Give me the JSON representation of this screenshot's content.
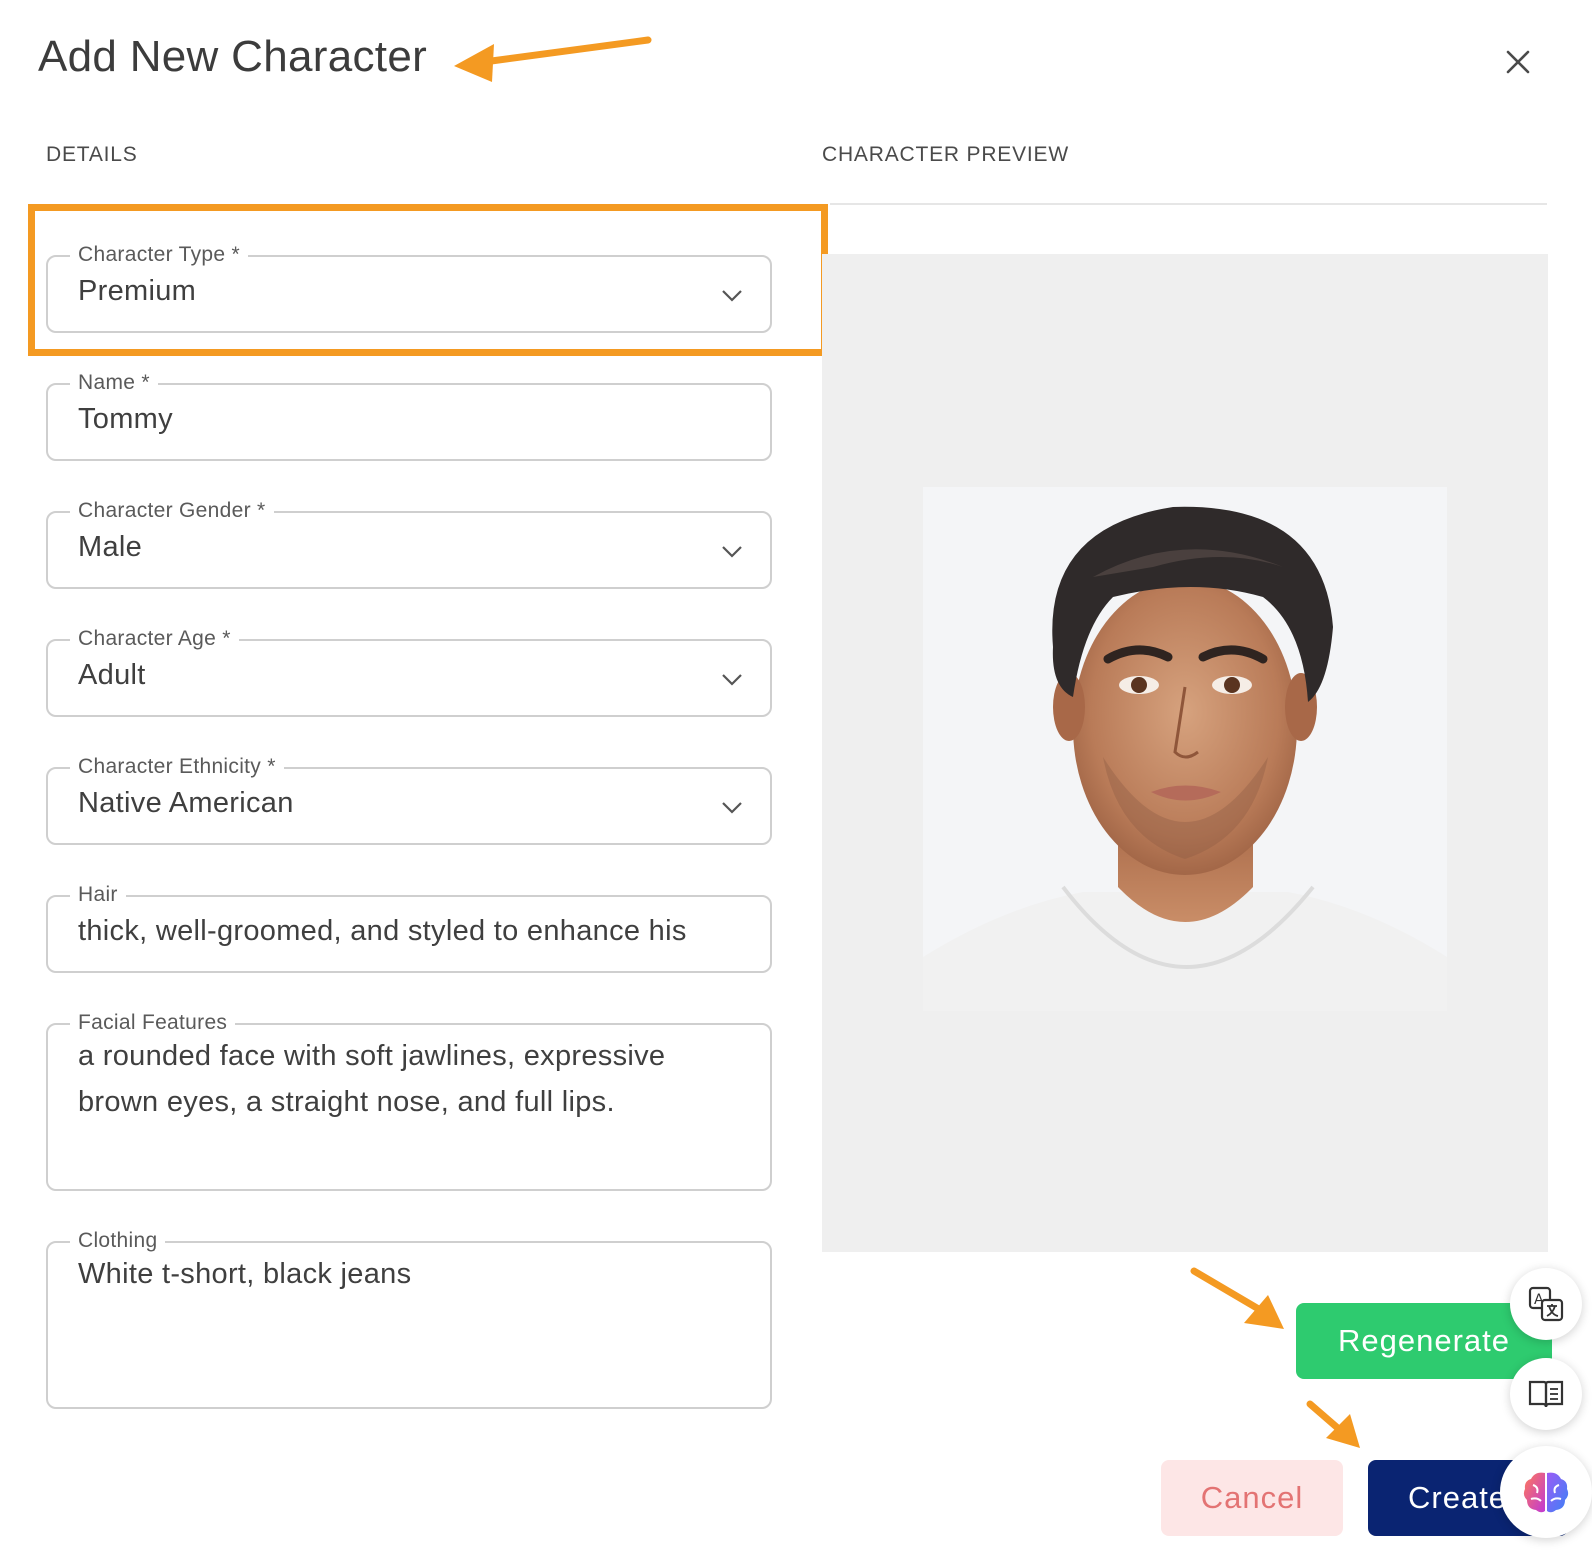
{
  "dialog": {
    "title": "Add New Character",
    "close_icon": "close-icon"
  },
  "sections": {
    "details": "DETAILS",
    "preview": "CHARACTER PREVIEW"
  },
  "form": {
    "character_type": {
      "label": "Character Type *",
      "value": "Premium"
    },
    "name": {
      "label": "Name *",
      "value": "Tommy"
    },
    "gender": {
      "label": "Character Gender *",
      "value": "Male"
    },
    "age": {
      "label": "Character Age *",
      "value": "Adult"
    },
    "ethnicity": {
      "label": "Character Ethnicity *",
      "value": "Native American"
    },
    "hair": {
      "label": "Hair",
      "value": "thick, well-groomed, and styled to enhance his"
    },
    "facial_features": {
      "label": "Facial Features",
      "value": "a rounded face with soft jawlines, expressive brown eyes, a straight nose, and full lips."
    },
    "clothing": {
      "label": "Clothing",
      "value": "White t-short, black jeans"
    }
  },
  "buttons": {
    "regenerate": "Regenerate",
    "cancel": "Cancel",
    "create": "Create"
  },
  "floating_icons": [
    "translate-icon",
    "book-icon",
    "brain-icon"
  ],
  "annotation_color": "#f49a22",
  "colors": {
    "regenerate_bg": "#2ecb6f",
    "create_bg": "#0a2472",
    "cancel_bg": "#fde6e6",
    "cancel_text": "#e37373"
  }
}
